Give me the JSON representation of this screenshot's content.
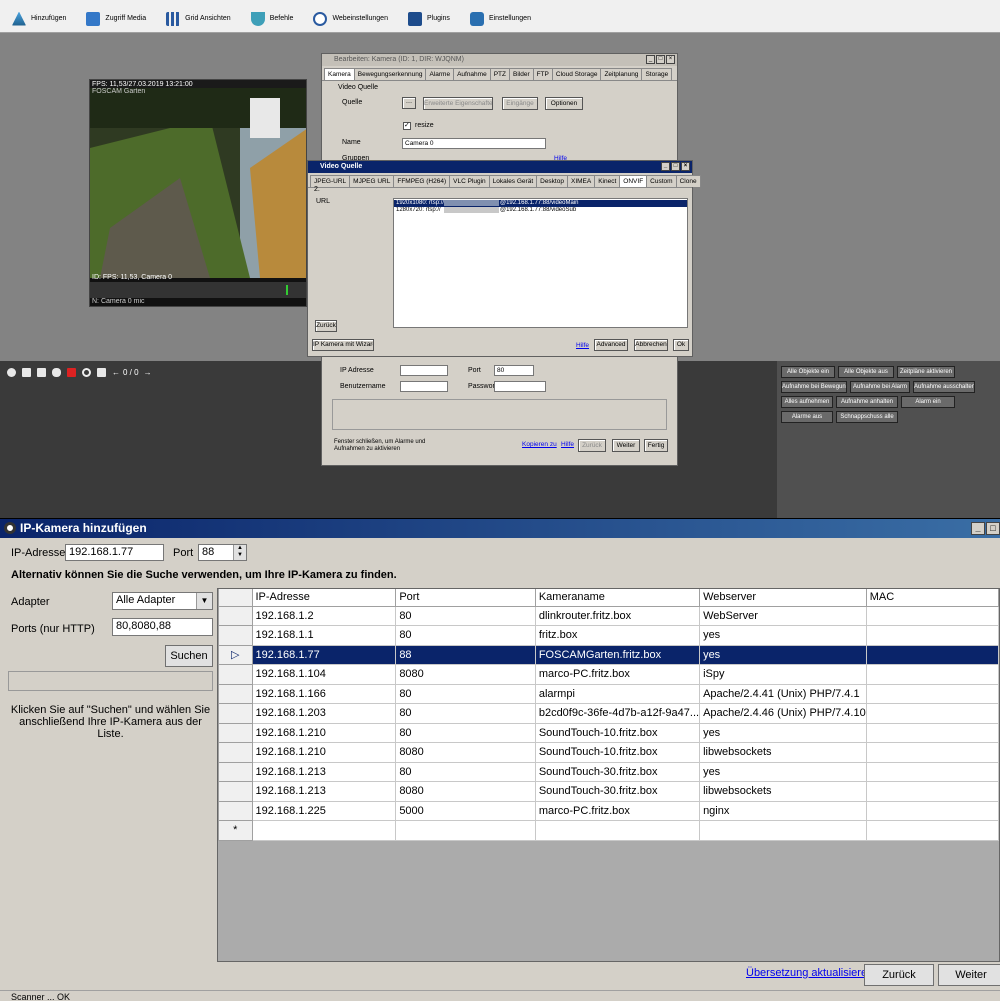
{
  "toolbar": {
    "items": [
      {
        "label": "Hinzufügen"
      },
      {
        "label": "Zugriff Media"
      },
      {
        "label": "Grid Ansichten"
      },
      {
        "label": "Befehle"
      },
      {
        "label": "Webeinstellungen"
      },
      {
        "label": "Plugins"
      },
      {
        "label": "Einstellungen"
      }
    ]
  },
  "camera": {
    "overlay_top": "FPS: 11,53/27.03.2019 13:21:00",
    "overlay_sub": "FOSCAM Garten",
    "overlay_bottom": "ID: FPS: 11,53, Camera 0",
    "footer": "N: Camera 0 mic"
  },
  "strip": {
    "counter": "0 / 0"
  },
  "objects": {
    "buttons": [
      "Alle Objekte ein",
      "Alle Objekte aus",
      "Zeitpläne aktivieren",
      "Aufnahme bei Bewegung",
      "Aufnahme bei Alarm",
      "Aufnahme ausschalten",
      "Alles aufnehmen",
      "Aufnahme anhalten",
      "Alarm ein",
      "Alarme aus",
      "Schnappschuss alle"
    ]
  },
  "edit": {
    "title": "Bearbeiten: Kamera (ID: 1, DIR: WJQNM)",
    "tabs": [
      "Kamera",
      "Bewegungserkennung",
      "Alarme",
      "Aufnahme",
      "PTZ",
      "Bilder",
      "FTP",
      "Cloud Storage",
      "Zeitplanung",
      "Storage"
    ],
    "group": "Video Quelle",
    "source_label": "Quelle",
    "btn_ext": "Erweiterte Eigenschaften",
    "btn_inputs": "Eingänge",
    "btn_options": "Optionen",
    "resize": "resize",
    "name_label": "Name",
    "name_value": "Camera 0",
    "groups_label": "Gruppen",
    "help": "Hilfe",
    "ip_label": "IP Adresse",
    "port_label": "Port",
    "port_value": "80",
    "user_label": "Benutzername",
    "pass_label": "Passwort",
    "footer_text": "Fenster schließen, um Alarme und Aufnahmen zu aktivieren",
    "copy": "Kopieren zu",
    "help2": "Hilfe",
    "back": "Zurück",
    "next": "Weiter",
    "finish": "Fertig"
  },
  "video": {
    "title": "Video Quelle",
    "tabs": [
      "JPEG-URL",
      "MJPEG URL",
      "FFMPEG (H264)",
      "VLC Plugin",
      "Lokales Gerät",
      "Desktop",
      "XIMEA",
      "Kinect",
      "ONVIF",
      "Custom",
      "Clone"
    ],
    "selected_tab": "ONVIF",
    "step": "2.",
    "url_label": "URL",
    "urls": [
      {
        "a": "1920x1080: rtsp://",
        "b": "@192.168.1.77:88/videoMain"
      },
      {
        "a": "1280x720: rtsp://",
        "b": "@192.168.1.77:88/videoSub"
      }
    ],
    "back": "Zurück",
    "wizard": "IP Kamera mit Wizard",
    "help": "Hilfe",
    "advanced": "Advanced",
    "cancel": "Abbrechen",
    "ok": "Ok"
  },
  "dialog": {
    "title": "IP-Kamera hinzufügen",
    "ip_label": "IP-Adresse",
    "ip_value": "192.168.1.77",
    "port_label": "Port",
    "port_value": "88",
    "hint": "Alternativ können Sie die Suche verwenden, um Ihre IP-Kamera zu finden.",
    "adapter_label": "Adapter",
    "adapter_value": "Alle Adapter",
    "ports_label": "Ports (nur HTTP)",
    "ports_value": "80,8080,88",
    "search": "Suchen",
    "instructions": "Klicken Sie auf \"Suchen\" und wählen Sie anschließend Ihre IP-Kamera aus der Liste.",
    "columns": [
      "IP-Adresse",
      "Port",
      "Kameraname",
      "Webserver",
      "MAC"
    ],
    "rows": [
      [
        "192.168.1.2",
        "80",
        "dlinkrouter.fritz.box",
        "WebServer",
        ""
      ],
      [
        "192.168.1.1",
        "80",
        "fritz.box",
        "yes",
        ""
      ],
      [
        "192.168.1.77",
        "88",
        "FOSCAMGarten.fritz.box",
        "yes",
        ""
      ],
      [
        "192.168.1.104",
        "8080",
        "marco-PC.fritz.box",
        "iSpy",
        ""
      ],
      [
        "192.168.1.166",
        "80",
        "alarmpi",
        "Apache/2.4.41 (Unix) PHP/7.4.1",
        ""
      ],
      [
        "192.168.1.203",
        "80",
        "b2cd0f9c-36fe-4d7b-a12f-9a47...",
        "Apache/2.4.46 (Unix) PHP/7.4.10",
        ""
      ],
      [
        "192.168.1.210",
        "80",
        "SoundTouch-10.fritz.box",
        "yes",
        ""
      ],
      [
        "192.168.1.210",
        "8080",
        "SoundTouch-10.fritz.box",
        "libwebsockets",
        ""
      ],
      [
        "192.168.1.213",
        "80",
        "SoundTouch-30.fritz.box",
        "yes",
        ""
      ],
      [
        "192.168.1.213",
        "8080",
        "SoundTouch-30.fritz.box",
        "libwebsockets",
        ""
      ],
      [
        "192.168.1.225",
        "5000",
        "marco-PC.fritz.box",
        "nginx",
        ""
      ]
    ],
    "selected_row": 2,
    "new_row_marker": "*",
    "link": "Übersetzung aktualisieren",
    "back": "Zurück",
    "next": "Weiter"
  },
  "statusbar": {
    "text": "Scanner ... OK"
  },
  "colors": {
    "title_blue": "#0a246a",
    "selection": "#0a246a",
    "window_bg": "#d4d0c8"
  }
}
